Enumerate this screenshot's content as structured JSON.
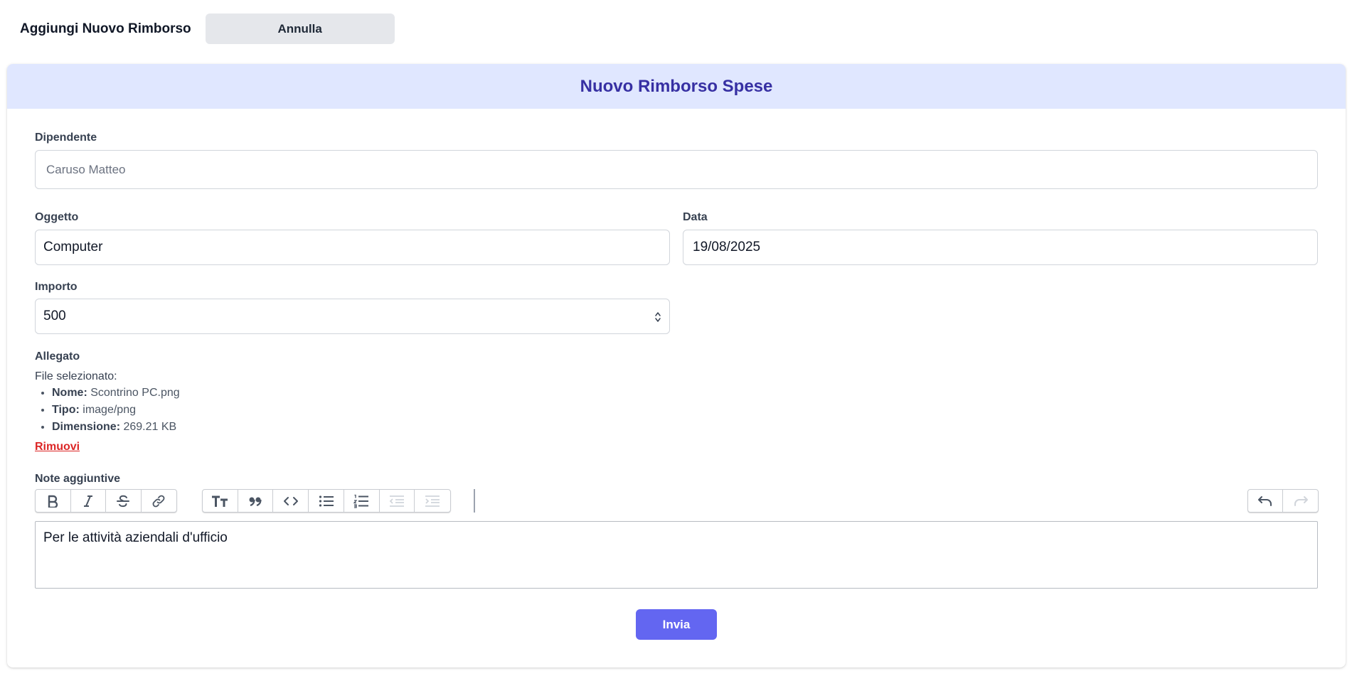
{
  "header": {
    "title": "Aggiungi Nuovo Rimborso",
    "cancel_label": "Annulla"
  },
  "form": {
    "title": "Nuovo Rimborso Spese",
    "employee": {
      "label": "Dipendente",
      "value": "Caruso Matteo"
    },
    "subject": {
      "label": "Oggetto",
      "value": "Computer"
    },
    "date": {
      "label": "Data",
      "value": "19/08/2025"
    },
    "amount": {
      "label": "Importo",
      "value": "500"
    },
    "attachment": {
      "label": "Allegato",
      "selected_text": "File selezionato:",
      "name_label": "Nome:",
      "name_value": "Scontrino PC.png",
      "type_label": "Tipo:",
      "type_value": "image/png",
      "size_label": "Dimensione:",
      "size_value": "269.21 KB",
      "remove_label": "Rimuovi"
    },
    "notes": {
      "label": "Note aggiuntive",
      "content": "Per le attività aziendali d'ufficio"
    },
    "submit_label": "Invia"
  },
  "toolbar_icons": {
    "group1": [
      "bold-icon",
      "italic-icon",
      "strikethrough-icon",
      "link-icon"
    ],
    "group2": [
      "heading-icon",
      "quote-icon",
      "code-icon",
      "bullet-list-icon",
      "numbered-list-icon",
      "outdent-icon",
      "indent-icon"
    ],
    "group3": [
      "undo-icon",
      "redo-icon"
    ]
  },
  "colors": {
    "header_bg": "#e0e7ff",
    "title": "#3730a3",
    "submit_bg": "#6366f1",
    "remove_link": "#dc2626",
    "cancel_bg": "#e5e7eb"
  }
}
